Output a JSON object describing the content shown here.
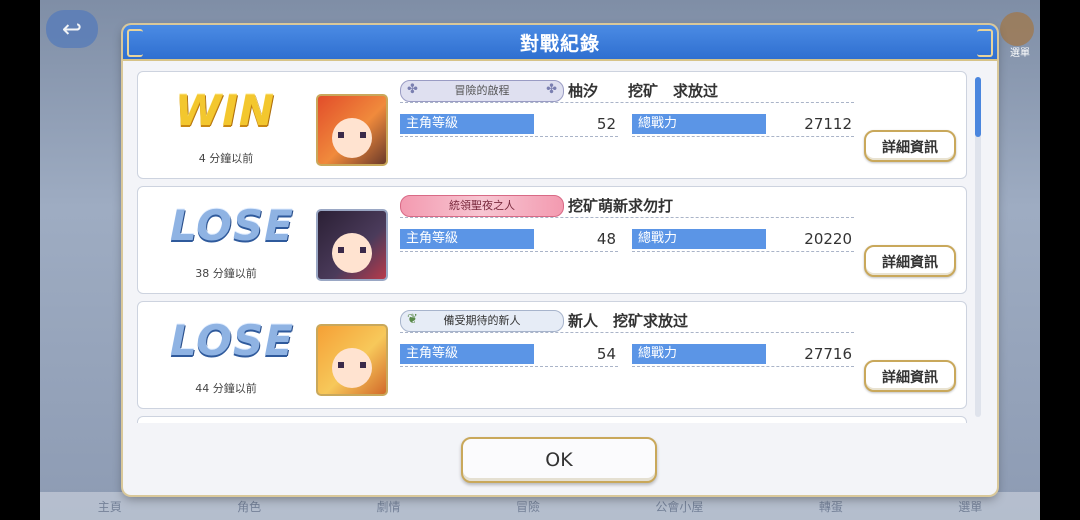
{
  "background": {
    "back_icon": "↩",
    "menu_label": "選單",
    "bottom_tabs": [
      "主頁",
      "角色",
      "劇情",
      "冒險",
      "公會小屋",
      "轉蛋",
      "選單"
    ]
  },
  "dialog": {
    "title": "對戰紀錄",
    "ok_label": "OK",
    "records": [
      {
        "result": "WIN",
        "time_ago": "4 分鐘以前",
        "title_badge": "冒險的啟程",
        "player_name": "柚汐　　挖矿　求放过",
        "level_label": "主角等級",
        "level": "52",
        "power_label": "總戰力",
        "power": "27112",
        "detail_label": "詳細資訊"
      },
      {
        "result": "LOSE",
        "time_ago": "38 分鐘以前",
        "title_badge": "統領聖夜之人",
        "player_name": "挖矿萌新求勿打",
        "level_label": "主角等級",
        "level": "48",
        "power_label": "總戰力",
        "power": "20220",
        "detail_label": "詳細資訊"
      },
      {
        "result": "LOSE",
        "time_ago": "44 分鐘以前",
        "title_badge": "備受期待的新人",
        "player_name": "新人　挖矿求放过",
        "level_label": "主角等級",
        "level": "54",
        "power_label": "總戰力",
        "power": "27716",
        "detail_label": "詳細資訊"
      }
    ]
  },
  "colors": {
    "header_blue": "#2f6fd0",
    "stat_blue": "#5b95e6",
    "gold_border": "#c9a85b",
    "win_yellow": "#f3c72e",
    "lose_blue": "#8fb3e3"
  },
  "icons": {
    "badge_decor": "club-icon",
    "badge_wreath": "wreath-icon"
  }
}
